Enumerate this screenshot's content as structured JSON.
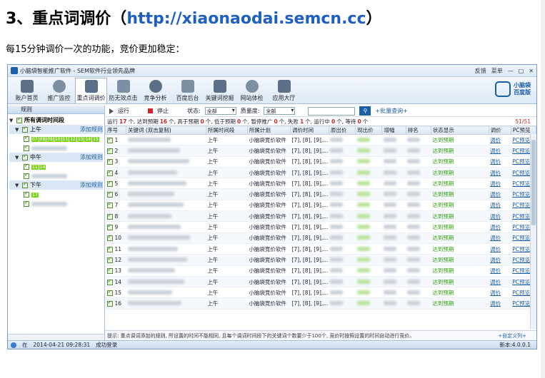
{
  "doc": {
    "heading_prefix": "3、重点词调价（",
    "heading_url": "http://xiaonaodai.semcn.cc",
    "heading_suffix": "）",
    "subtitle": "每15分钟调价一次的功能，竞价更加稳定："
  },
  "app": {
    "title": "小脑袋智能推广软件 - SEM软件行业领先品牌",
    "top_right": [
      "反馈",
      "菜单",
      "—",
      "□",
      "✕"
    ],
    "nav": [
      {
        "label": "账户首页",
        "icon": "home-icon"
      },
      {
        "label": "推广监控",
        "icon": "monitor-icon"
      },
      {
        "label": "重点词调价",
        "icon": "document-icon",
        "active": true
      },
      {
        "label": "防无效点击",
        "icon": "mouse-icon"
      },
      {
        "label": "竞争分析",
        "icon": "pie-chart-icon"
      },
      {
        "label": "百度后台",
        "icon": "baidu-paw-icon"
      },
      {
        "label": "关键词挖掘",
        "icon": "terminal-icon"
      },
      {
        "label": "网站体检",
        "icon": "gauge-icon"
      },
      {
        "label": "应用大厅",
        "icon": "computer-icon"
      }
    ],
    "brand": {
      "line1": "小脑袋",
      "line2": "百度版"
    },
    "left": {
      "header": "规则",
      "root": "所有调词时间段",
      "groups": [
        {
          "label": "上午",
          "add": "添加规则",
          "chips": [
            "07",
            "08",
            "09",
            "10",
            "11",
            "12",
            "13",
            "14",
            "15"
          ]
        },
        {
          "label": "中午",
          "add": "添加规则",
          "chips": [
            "11",
            "14"
          ]
        },
        {
          "label": "下午",
          "add": "添加规则",
          "chips": [
            "17"
          ]
        }
      ]
    },
    "toolbar": {
      "run": "运行",
      "stop": "停止",
      "status_label": "状态:",
      "status_value": "全部",
      "quality_label": "质量度:",
      "quality_value": "全部",
      "bulk_query": "+批量查询+"
    },
    "status_line": {
      "p1": "运行",
      "n1": "17",
      "p2": "个, 达到预期",
      "n2": "16",
      "p3": "个, 高于预期",
      "n3": "0",
      "p4": "个, 低于预期",
      "n4": "0",
      "p5": "个, 暂停推广",
      "n5": "0",
      "p6": "个, 失败",
      "n6": "1",
      "p7": "个, 运行中",
      "n7": "0",
      "p8": "个, 等待",
      "n8": "0",
      "p9": "个",
      "count": "51/51"
    },
    "table": {
      "columns": [
        "序号",
        "关键词 (双击复制)",
        "所属时间段",
        "所属计划",
        "调价时间",
        "原出价",
        "现出价",
        "增幅",
        "排名",
        "状态显示",
        "调价",
        "PC预览"
      ],
      "rows": [
        {
          "no": "1",
          "time": "上午",
          "plan": "小脑袋竞价软件",
          "adj": "[7], [8], [9],...",
          "status": "达到预期",
          "act": "调价",
          "prev": "PC预览"
        },
        {
          "no": "2",
          "time": "上午",
          "plan": "小脑袋竞价软件",
          "adj": "[7], [8], [9],...",
          "status": "达到预期",
          "act": "调价",
          "prev": "PC预览"
        },
        {
          "no": "3",
          "time": "上午",
          "plan": "小脑袋竞价软件",
          "adj": "[7], [8], [9],...",
          "status": "达到预期",
          "act": "调价",
          "prev": "PC预览"
        },
        {
          "no": "4",
          "time": "上午",
          "plan": "小脑袋竞价软件",
          "adj": "[7], [8], [9],...",
          "status": "达到预期",
          "act": "调价",
          "prev": "PC预览"
        },
        {
          "no": "5",
          "time": "上午",
          "plan": "小脑袋竞价软件",
          "adj": "[7], [8], [9],...",
          "status": "达到预期",
          "act": "调价",
          "prev": "PC预览"
        },
        {
          "no": "6",
          "time": "上午",
          "plan": "小脑袋竞价软件",
          "adj": "[7], [8], [9],...",
          "status": "达到预期",
          "act": "调价",
          "prev": "PC预览"
        },
        {
          "no": "7",
          "time": "上午",
          "plan": "小脑袋竞价软件",
          "adj": "[7], [8], [9],...",
          "status": "达到预期",
          "act": "调价",
          "prev": "PC预览"
        },
        {
          "no": "8",
          "time": "上午",
          "plan": "小脑袋竞价软件",
          "adj": "[7], [8], [9],...",
          "status": "达到预期",
          "act": "调价",
          "prev": "PC预览"
        },
        {
          "no": "9",
          "time": "上午",
          "plan": "小脑袋竞价软件",
          "adj": "[7], [8], [9],...",
          "status": "达到预期",
          "act": "调价",
          "prev": "PC预览"
        },
        {
          "no": "10",
          "time": "上午",
          "plan": "小脑袋竞价软件",
          "adj": "[7], [8], [9],...",
          "status": "达到预期",
          "act": "调价",
          "prev": "PC预览"
        },
        {
          "no": "11",
          "time": "上午",
          "plan": "小脑袋竞价软件",
          "adj": "[7], [8], [9],...",
          "status": "达到预期",
          "act": "调价",
          "prev": "PC预览"
        },
        {
          "no": "12",
          "time": "上午",
          "plan": "小脑袋竞价软件",
          "adj": "[7], [8], [9],...",
          "status": "达到预期",
          "act": "调价",
          "prev": "PC预览"
        },
        {
          "no": "13",
          "time": "上午",
          "plan": "小脑袋竞价软件",
          "adj": "[7], [8], [9],...",
          "status": "达到预期",
          "act": "调价",
          "prev": "PC预览"
        },
        {
          "no": "14",
          "time": "上午",
          "plan": "小脑袋竞价软件",
          "adj": "[7], [8], [9],...",
          "status": "达到预期",
          "act": "调价",
          "prev": "PC预览"
        },
        {
          "no": "15",
          "time": "上午",
          "plan": "小脑袋竞价软件",
          "adj": "[7], [8], [9],...",
          "status": "达到预期",
          "act": "调价",
          "prev": "PC预览"
        },
        {
          "no": "16",
          "time": "上午",
          "plan": "小脑袋竞价软件",
          "adj": "[7], [8], [9],...",
          "status": "达到预期",
          "act": "调价",
          "prev": "PC预览"
        }
      ]
    },
    "tip": "提示: 重点调词添加的规则, 所设置的时间不能相同, 且每个调词时间段下的关键词个数要少于100个, 竞价时按照设置的时间自动进行竞价。",
    "custom": "+自定义列+",
    "statusbar": {
      "at": "在",
      "time": "2014-04-21 09:28:31",
      "msg": "成功登录",
      "version": "新本:4.0.0.1"
    }
  }
}
